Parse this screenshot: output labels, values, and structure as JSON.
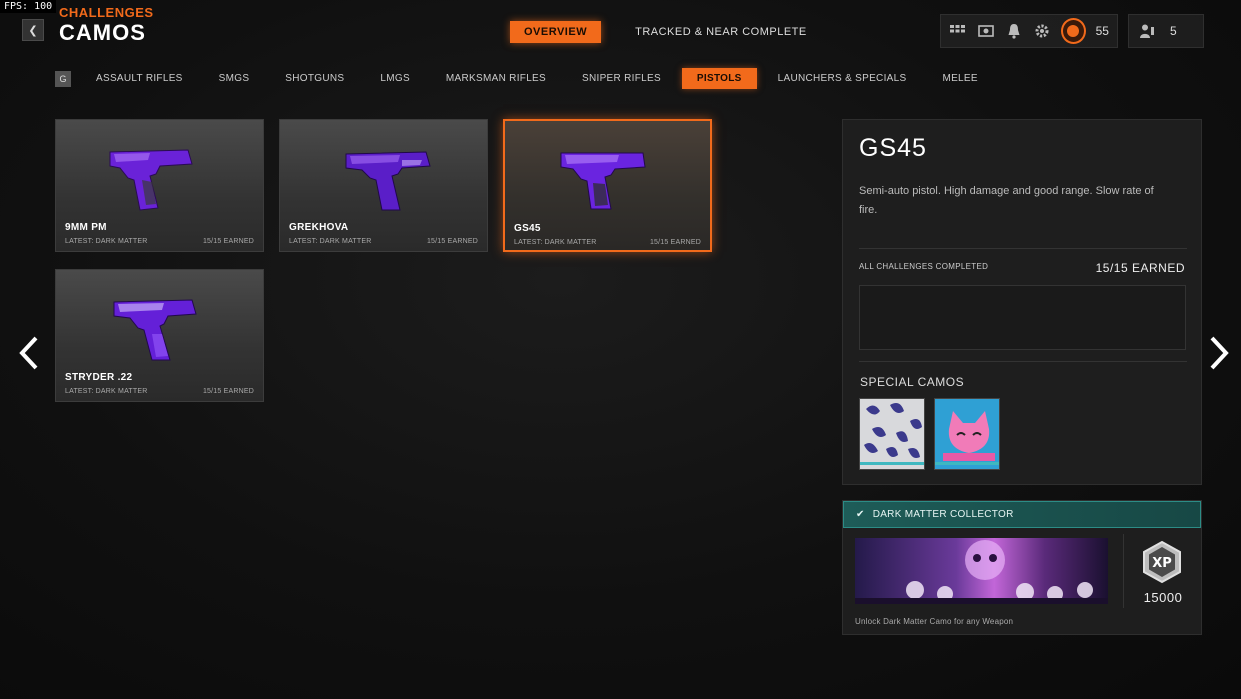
{
  "overlay": {
    "fps": "FPS: 100"
  },
  "header": {
    "breadcrumb": "CHALLENGES",
    "title": "CAMOS",
    "tabs": [
      {
        "label": "OVERVIEW",
        "active": true
      },
      {
        "label": "TRACKED & NEAR COMPLETE",
        "active": false
      }
    ],
    "level": "55",
    "party_count": "5"
  },
  "categories": {
    "key_hint": "G",
    "items": [
      {
        "label": "ASSAULT RIFLES",
        "active": false
      },
      {
        "label": "SMGS",
        "active": false
      },
      {
        "label": "SHOTGUNS",
        "active": false
      },
      {
        "label": "LMGS",
        "active": false
      },
      {
        "label": "MARKSMAN RIFLES",
        "active": false
      },
      {
        "label": "SNIPER RIFLES",
        "active": false
      },
      {
        "label": "PISTOLS",
        "active": true
      },
      {
        "label": "LAUNCHERS & SPECIALS",
        "active": false
      },
      {
        "label": "MELEE",
        "active": false
      }
    ]
  },
  "weapons": [
    {
      "name": "9MM PM",
      "latest": "LATEST: DARK MATTER",
      "earned": "15/15 EARNED",
      "selected": false
    },
    {
      "name": "GREKHOVA",
      "latest": "LATEST: DARK MATTER",
      "earned": "15/15 EARNED",
      "selected": false
    },
    {
      "name": "GS45",
      "latest": "LATEST: DARK MATTER",
      "earned": "15/15 EARNED",
      "selected": true
    },
    {
      "name": "STRYDER .22",
      "latest": "LATEST: DARK MATTER",
      "earned": "15/15 EARNED",
      "selected": false
    }
  ],
  "details": {
    "name": "GS45",
    "description": "Semi-auto pistol.  High damage and good range. Slow rate of fire.",
    "challenges_label": "ALL CHALLENGES COMPLETED",
    "earned": "15/15 EARNED",
    "special_camos_label": "SPECIAL CAMOS"
  },
  "reward": {
    "title": "DARK MATTER COLLECTOR",
    "xp": "15000",
    "note": "Unlock Dark Matter Camo for any Weapon"
  },
  "colors": {
    "accent": "#f26a1b",
    "camo_purple": "#7a2cf0",
    "reward_teal": "#1e5c58",
    "swatch_bar": "#3fb8c0"
  }
}
